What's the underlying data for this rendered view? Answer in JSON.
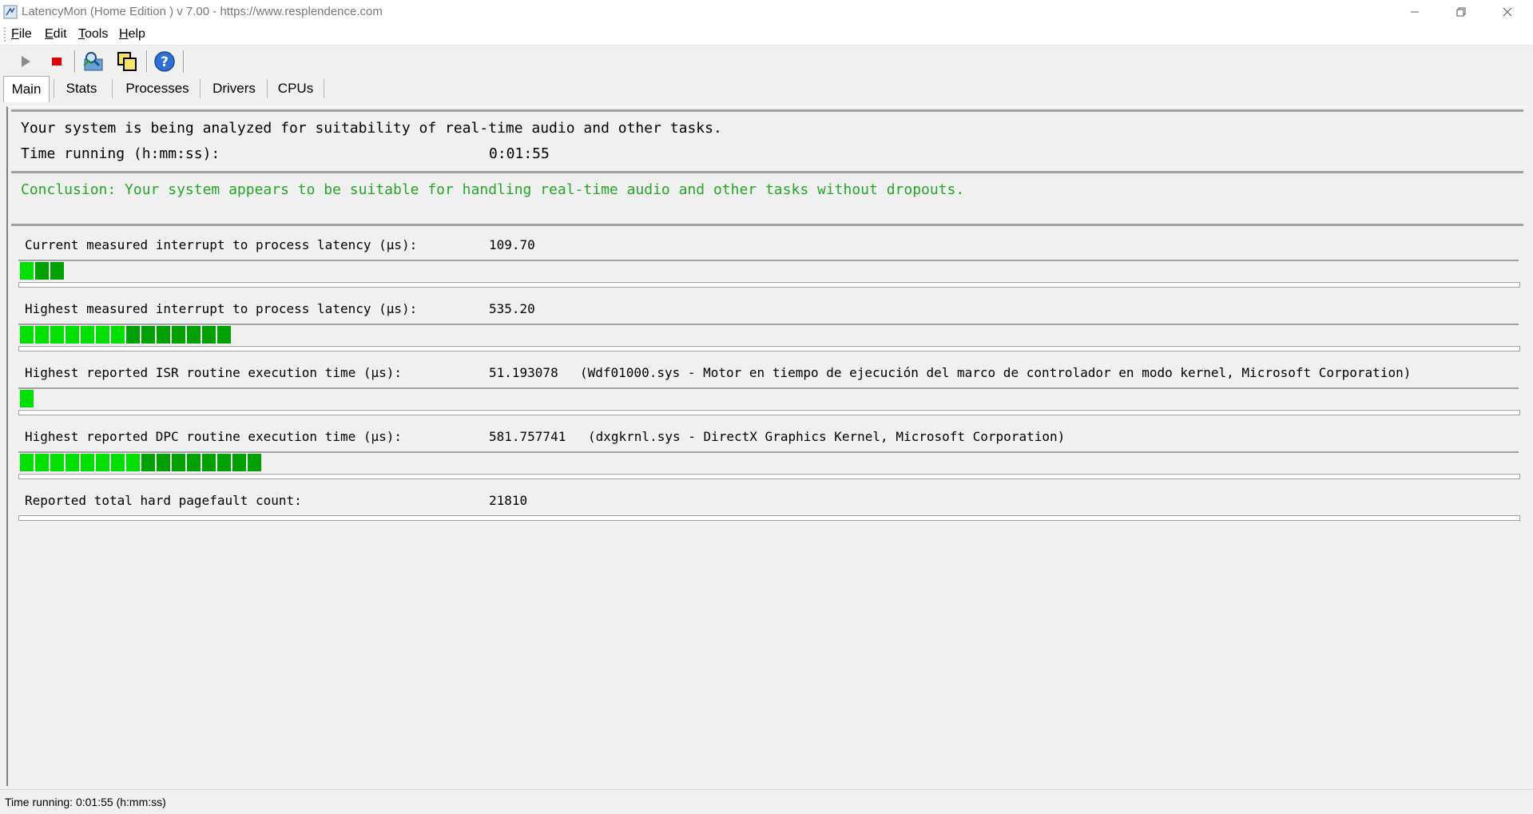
{
  "window": {
    "title": "LatencyMon  (Home Edition )  v 7.00 - https://www.resplendence.com"
  },
  "menu": [
    "File",
    "Edit",
    "Tools",
    "Help"
  ],
  "toolbar": {
    "buttons": [
      "play-icon",
      "stop-icon",
      "analyze-icon",
      "copy-icon",
      "help-icon"
    ]
  },
  "tabs": [
    "Main",
    "Stats",
    "Processes",
    "Drivers",
    "CPUs"
  ],
  "active_tab": "Main",
  "status": {
    "line": "Your system is being analyzed for suitability of real-time audio and other tasks.",
    "time_label": "Time running (h:mm:ss):",
    "time_value": "0:01:55"
  },
  "conclusion": {
    "text": "Conclusion: Your system appears to be suitable for handling real-time audio and other tasks without dropouts.",
    "color": "#22a822"
  },
  "metrics": [
    {
      "label": "Current measured interrupt to process latency (µs):",
      "value": "109.70",
      "desc": "",
      "meter_segments": 3
    },
    {
      "label": "Highest measured interrupt to process latency (µs):",
      "value": "535.20",
      "desc": "",
      "meter_segments": 14
    },
    {
      "label": "Highest reported ISR routine execution time (µs):",
      "value": "51.193078",
      "desc": "(Wdf01000.sys - Motor en tiempo de ejecución del marco de controlador en modo kernel, Microsoft Corporation)",
      "meter_segments": 1
    },
    {
      "label": "Highest reported DPC routine execution time (µs):",
      "value": "581.757741",
      "desc": "(dxgkrnl.sys - DirectX Graphics Kernel, Microsoft Corporation)",
      "meter_segments": 16
    },
    {
      "label": "Reported total hard pagefault count:",
      "value": "21810",
      "desc": "",
      "meter_segments": 0
    }
  ],
  "statusbar": {
    "text": "Time running: 0:01:55  (h:mm:ss)"
  },
  "colors": {
    "meter_green_light": "#00e000",
    "meter_green_dark": "#00a000"
  }
}
